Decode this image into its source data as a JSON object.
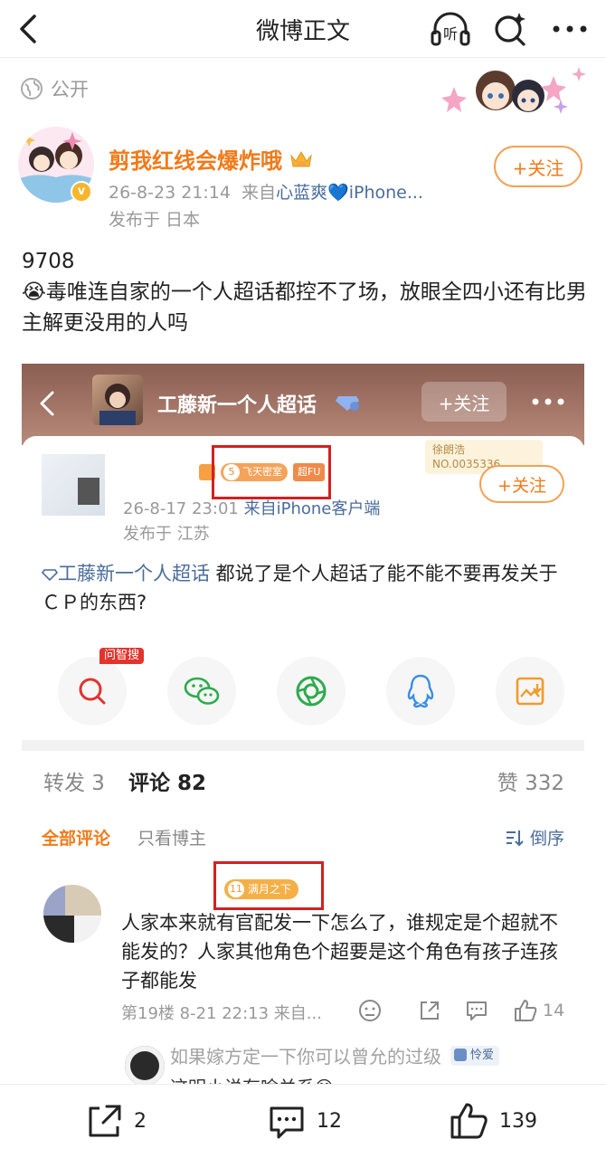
{
  "nav": {
    "title": "微博正文",
    "listen_label": "听"
  },
  "post": {
    "visibility": "公开",
    "author": "剪我红线会爆炸哦",
    "verified_mark": "v",
    "time": "26-8-23 21:14",
    "source_prefix": "来自",
    "source": "心蓝爽💙iPhone...",
    "location": "发布于 日本",
    "follow_label": "+关注",
    "text_line1": "9708",
    "text_line2": "😭毒唯连自家的一个人超话都控不了场，放眼全四小还有比男主解更没用的人吗"
  },
  "embed": {
    "topic_name": "工藤新一个人超话",
    "follow_label": "+关注",
    "badge_level": "5",
    "badge_name": "飞天密室",
    "badge_tag": "超FU",
    "card_label": "徐朗浩",
    "card_no": "NO.0035336",
    "follow2_label": "+关注",
    "time": "26-8-17 23:01",
    "source": "来自iPhone客户端",
    "location": "发布于 江苏",
    "topic_tag": "工藤新一个人超话",
    "text": " 都说了是个人超话了能不能不要再发关于ＣＰ的东西?",
    "search_badge": "问智搜"
  },
  "tabs": {
    "repost": "转发 3",
    "comment": "评论 82",
    "like": "赞 332",
    "filter_all": "全部评论",
    "filter_owner": "只看博主",
    "sort": "倒序"
  },
  "comment": {
    "medal_level": "11",
    "medal_name": "满月之下",
    "text": "人家本来就有官配发一下怎么了，谁规定是个超就不能发的？人家其他角色个超要是这个角色有孩子连孩子都能发",
    "meta": "第19楼 8-21 22:13 来自...",
    "like_count": "14"
  },
  "reply": {
    "text1": "如果嫁方定一下你可以曾允的过级",
    "badge": "怜爱",
    "text2": "这明小说有啥关系😄"
  },
  "bottom": {
    "repost_count": "2",
    "comment_count": "12",
    "like_count": "139"
  },
  "colors": {
    "accent": "#f07a1a",
    "link": "#4a6c9c",
    "highlight_box": "#d42020"
  }
}
